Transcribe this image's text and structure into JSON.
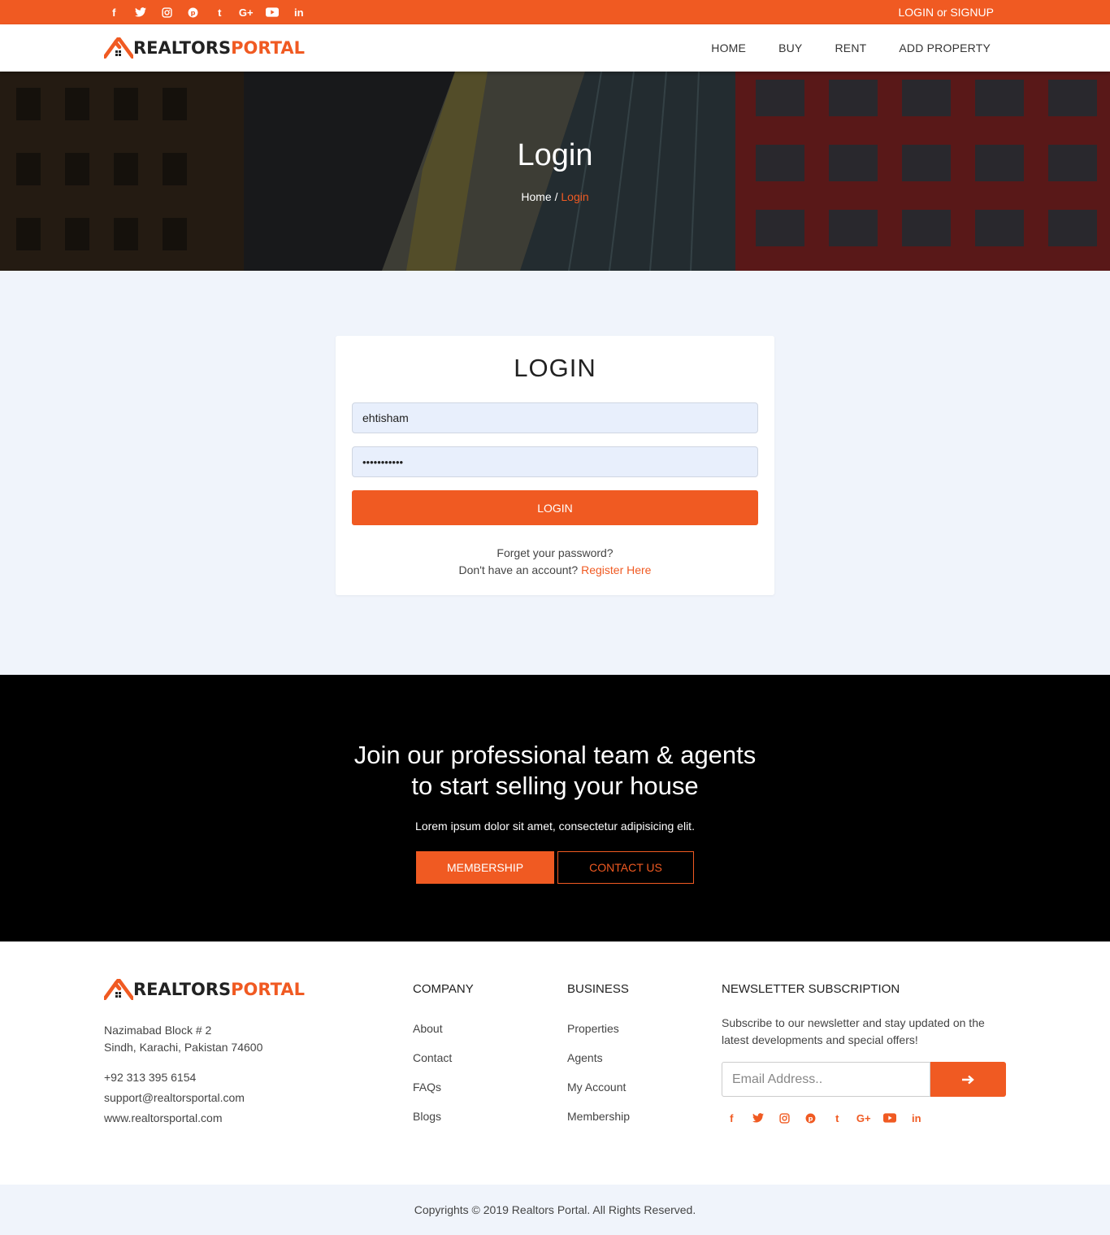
{
  "topbar": {
    "socials": [
      {
        "icon": "facebook-icon",
        "glyph": "f"
      },
      {
        "icon": "twitter-icon",
        "glyph": "🐦"
      },
      {
        "icon": "instagram-icon",
        "glyph": "◎"
      },
      {
        "icon": "pinterest-icon",
        "glyph": "℗"
      },
      {
        "icon": "tumblr-icon",
        "glyph": "t"
      },
      {
        "icon": "google-plus-icon",
        "glyph": "G+"
      },
      {
        "icon": "youtube-icon",
        "glyph": "▶"
      },
      {
        "icon": "linkedin-icon",
        "glyph": "in"
      }
    ],
    "login": "LOGIN",
    "or": "or",
    "signup": "SIGNUP"
  },
  "brand": {
    "part1": "REALTORS",
    "part2": "PORTAL",
    "accent": "#f05a22"
  },
  "nav": {
    "home": "HOME",
    "buy": "BUY",
    "rent": "RENT",
    "add_property": "ADD PROPERTY"
  },
  "hero": {
    "title": "Login",
    "crumb_home": "Home",
    "crumb_sep": "/",
    "crumb_current": "Login"
  },
  "login_form": {
    "heading": "LOGIN",
    "username_value": "ehtisham",
    "password_value": "•••••••••••",
    "submit_label": "LOGIN",
    "forgot": "Forget your password?",
    "no_account": "Don't have an account?",
    "register": "Register Here"
  },
  "cta": {
    "heading_line1": "Join our professional team & agents",
    "heading_line2": "to start selling your house",
    "text": "Lorem ipsum dolor sit amet, consectetur adipisicing elit.",
    "membership": "MEMBERSHIP",
    "contact": "CONTACT US"
  },
  "footer": {
    "address1": "Nazimabad Block # 2",
    "address2": "Sindh, Karachi, Pakistan 74600",
    "phone": "+92 313 395 6154",
    "email": "support@realtorsportal.com",
    "website": "www.realtorsportal.com",
    "company_heading": "COMPANY",
    "company_links": [
      "About",
      "Contact",
      "FAQs",
      "Blogs"
    ],
    "business_heading": "BUSINESS",
    "business_links": [
      "Properties",
      "Agents",
      "My Account",
      "Membership"
    ],
    "newsletter_heading": "NEWSLETTER SUBSCRIPTION",
    "newsletter_text": "Subscribe to our newsletter and stay updated on the latest developments and special offers!",
    "email_placeholder": "Email Address..",
    "submit_icon": "arrow-right-icon"
  },
  "copyright": "Copyrights © 2019 Realtors Portal. All Rights Reserved."
}
